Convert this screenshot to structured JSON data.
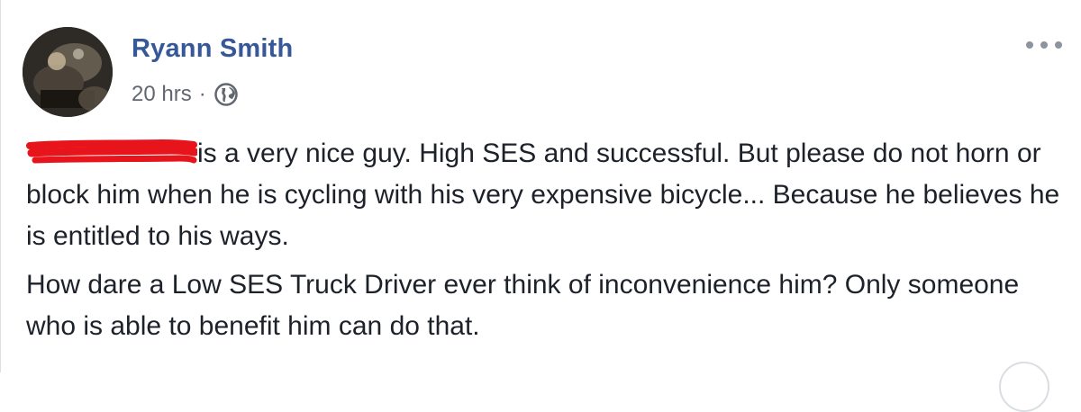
{
  "post": {
    "author": "Ryann Smith",
    "time": "20 hrs",
    "separator": "·",
    "privacy_icon": "globe-icon",
    "menu_icon": "more-options-icon",
    "paragraph1_text": "is a very nice guy. High SES and successful. But please do not horn or block him when he is cycling with his very expensive bicycle... Because he believes he is entitled to his ways.",
    "paragraph2_text": "How dare a Low SES Truck Driver ever think of inconvenience him? Only someone who is able to benefit him can do that."
  },
  "colors": {
    "author_link": "#365899",
    "meta_text": "#616770",
    "body_text": "#1d2129",
    "redaction": "#e8141b"
  }
}
